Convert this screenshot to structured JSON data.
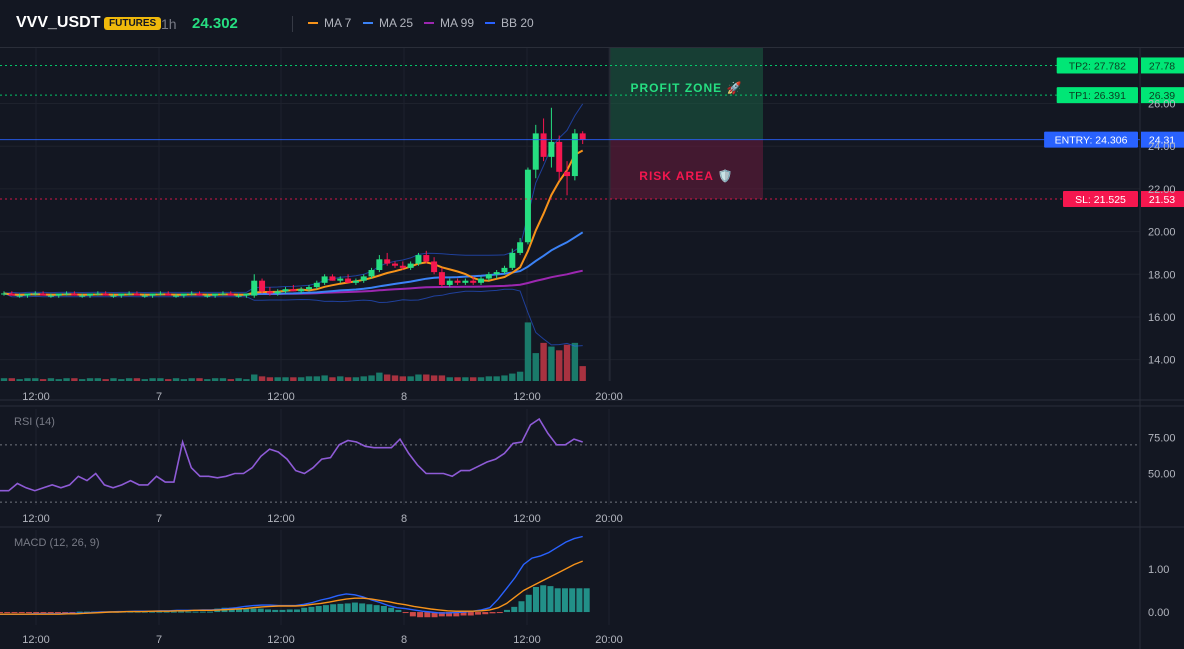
{
  "header": {
    "symbol": "VVV_USDT",
    "badge": "FUTURES",
    "timeframe": "1h",
    "price": "24.302",
    "legend": [
      {
        "label": "MA 7",
        "color": "#f7931a"
      },
      {
        "label": "MA 25",
        "color": "#3b82f6"
      },
      {
        "label": "MA 99",
        "color": "#9c27b0"
      },
      {
        "label": "BB 20",
        "color": "#2962ff"
      }
    ]
  },
  "colors": {
    "up": "#26de81",
    "down": "#f5174f",
    "vol_up": "#1a7a6a",
    "vol_down": "#a83240"
  },
  "time_labels": [
    "12:00",
    "7",
    "12:00",
    "8",
    "12:00",
    "20:00"
  ],
  "zones": {
    "profit": "PROFIT ZONE 🚀",
    "risk": "RISK AREA 🛡️"
  },
  "chart_data": [
    {
      "type": "candlestick",
      "title": "",
      "ylim": [
        13,
        28.6
      ],
      "y_ticks": [
        "14.00",
        "16.00",
        "18.00",
        "20.00",
        "22.00",
        "24.00",
        "26.00"
      ],
      "x_ticks": [
        "12:00",
        "7",
        "12:00",
        "8",
        "12:00",
        "20:00"
      ],
      "candles": [
        [
          17.1,
          17.2,
          17.0,
          17.1
        ],
        [
          17.1,
          17.2,
          17.0,
          17.0
        ],
        [
          17.0,
          17.1,
          16.9,
          17.0
        ],
        [
          17.0,
          17.1,
          16.9,
          17.1
        ],
        [
          17.1,
          17.2,
          17.0,
          17.1
        ],
        [
          17.1,
          17.2,
          17.0,
          17.0
        ],
        [
          17.0,
          17.1,
          16.9,
          17.0
        ],
        [
          17.0,
          17.1,
          16.9,
          17.1
        ],
        [
          17.1,
          17.2,
          17.0,
          17.1
        ],
        [
          17.1,
          17.2,
          17.0,
          17.0
        ],
        [
          17.0,
          17.1,
          16.9,
          17.0
        ],
        [
          17.0,
          17.1,
          16.9,
          17.1
        ],
        [
          17.1,
          17.2,
          17.0,
          17.1
        ],
        [
          17.1,
          17.2,
          17.0,
          17.0
        ],
        [
          17.0,
          17.1,
          16.9,
          17.0
        ],
        [
          17.0,
          17.1,
          16.9,
          17.1
        ],
        [
          17.1,
          17.2,
          17.0,
          17.1
        ],
        [
          17.1,
          17.2,
          17.0,
          17.0
        ],
        [
          17.0,
          17.1,
          16.9,
          17.0
        ],
        [
          17.0,
          17.1,
          16.9,
          17.1
        ],
        [
          17.1,
          17.2,
          17.0,
          17.1
        ],
        [
          17.1,
          17.2,
          17.0,
          17.0
        ],
        [
          17.0,
          17.1,
          16.9,
          17.0
        ],
        [
          17.0,
          17.1,
          16.9,
          17.1
        ],
        [
          17.1,
          17.2,
          17.0,
          17.1
        ],
        [
          17.1,
          17.2,
          17.0,
          17.0
        ],
        [
          17.0,
          17.1,
          16.9,
          17.0
        ],
        [
          17.0,
          17.1,
          16.9,
          17.1
        ],
        [
          17.1,
          17.2,
          17.0,
          17.1
        ],
        [
          17.1,
          17.2,
          17.0,
          17.0
        ],
        [
          17.0,
          17.1,
          16.9,
          17.0
        ],
        [
          17.0,
          17.1,
          16.9,
          17.1
        ],
        [
          17.0,
          18.0,
          16.9,
          17.7
        ],
        [
          17.7,
          17.8,
          17.1,
          17.2
        ],
        [
          17.2,
          17.4,
          17.0,
          17.1
        ],
        [
          17.1,
          17.3,
          17.0,
          17.2
        ],
        [
          17.2,
          17.4,
          17.1,
          17.3
        ],
        [
          17.3,
          17.5,
          17.2,
          17.2
        ],
        [
          17.2,
          17.4,
          17.1,
          17.3
        ],
        [
          17.3,
          17.5,
          17.2,
          17.4
        ],
        [
          17.4,
          17.7,
          17.3,
          17.6
        ],
        [
          17.6,
          18.0,
          17.5,
          17.9
        ],
        [
          17.9,
          18.0,
          17.7,
          17.7
        ],
        [
          17.7,
          17.9,
          17.6,
          17.8
        ],
        [
          17.8,
          18.0,
          17.6,
          17.6
        ],
        [
          17.6,
          17.8,
          17.5,
          17.7
        ],
        [
          17.7,
          18.0,
          17.6,
          17.9
        ],
        [
          17.9,
          18.3,
          17.8,
          18.2
        ],
        [
          18.2,
          18.9,
          18.1,
          18.7
        ],
        [
          18.7,
          19.0,
          18.4,
          18.5
        ],
        [
          18.5,
          18.6,
          18.3,
          18.4
        ],
        [
          18.4,
          18.6,
          18.2,
          18.3
        ],
        [
          18.3,
          18.6,
          18.2,
          18.5
        ],
        [
          18.5,
          19.0,
          18.4,
          18.9
        ],
        [
          18.9,
          19.1,
          18.5,
          18.6
        ],
        [
          18.6,
          18.8,
          18.0,
          18.1
        ],
        [
          18.1,
          18.3,
          17.4,
          17.5
        ],
        [
          17.5,
          17.8,
          17.4,
          17.7
        ],
        [
          17.7,
          17.8,
          17.5,
          17.6
        ],
        [
          17.6,
          17.8,
          17.5,
          17.7
        ],
        [
          17.7,
          17.9,
          17.5,
          17.6
        ],
        [
          17.6,
          17.9,
          17.5,
          17.8
        ],
        [
          17.8,
          18.1,
          17.7,
          18.0
        ],
        [
          18.0,
          18.2,
          17.8,
          18.1
        ],
        [
          18.1,
          18.4,
          18.0,
          18.3
        ],
        [
          18.3,
          19.2,
          18.2,
          19.0
        ],
        [
          19.0,
          19.7,
          18.9,
          19.5
        ],
        [
          19.5,
          23.0,
          19.4,
          22.9
        ],
        [
          22.9,
          25.0,
          22.5,
          24.6
        ],
        [
          24.6,
          25.3,
          23.3,
          23.5
        ],
        [
          23.5,
          25.8,
          23.0,
          24.2
        ],
        [
          24.2,
          24.5,
          22.4,
          22.8
        ],
        [
          22.8,
          23.3,
          21.7,
          22.6
        ],
        [
          22.6,
          24.8,
          22.4,
          24.6
        ],
        [
          24.6,
          24.7,
          24.1,
          24.3
        ]
      ],
      "volume": [
        0.3,
        0.3,
        0.2,
        0.3,
        0.3,
        0.2,
        0.3,
        0.2,
        0.3,
        0.3,
        0.2,
        0.3,
        0.3,
        0.2,
        0.3,
        0.2,
        0.3,
        0.3,
        0.2,
        0.3,
        0.3,
        0.2,
        0.3,
        0.2,
        0.3,
        0.3,
        0.2,
        0.3,
        0.3,
        0.2,
        0.3,
        0.2,
        0.7,
        0.5,
        0.4,
        0.4,
        0.4,
        0.4,
        0.4,
        0.5,
        0.5,
        0.6,
        0.4,
        0.5,
        0.4,
        0.4,
        0.5,
        0.6,
        0.9,
        0.7,
        0.6,
        0.5,
        0.5,
        0.7,
        0.7,
        0.6,
        0.6,
        0.4,
        0.4,
        0.4,
        0.4,
        0.4,
        0.5,
        0.5,
        0.6,
        0.8,
        1.0,
        6.3,
        3.0,
        4.1,
        3.7,
        3.3,
        3.9,
        4.1,
        1.6
      ],
      "levels": [
        {
          "label": "TP2: 27.782",
          "axis": "27.78",
          "value": 27.782,
          "color": "#00e676"
        },
        {
          "label": "TP1: 26.391",
          "axis": "26.39",
          "value": 26.391,
          "color": "#00e676"
        },
        {
          "label": "ENTRY: 24.306",
          "axis": "24.31",
          "value": 24.306,
          "color": "#2962ff"
        },
        {
          "label": "SL: 21.525",
          "axis": "21.53",
          "value": 21.525,
          "color": "#f5174f"
        }
      ]
    },
    {
      "type": "line",
      "title": "RSI (14)",
      "ylim": [
        28,
        95
      ],
      "y_ticks": [
        "75.00",
        "50.00"
      ],
      "bands": [
        70,
        30
      ],
      "x_ticks": [
        "12:00",
        "7",
        "12:00",
        "8",
        "12:00",
        "20:00"
      ],
      "values": [
        38,
        38,
        43,
        40,
        38,
        40,
        42,
        40,
        42,
        48,
        45,
        50,
        42,
        40,
        42,
        45,
        42,
        42,
        48,
        44,
        44,
        72,
        54,
        48,
        48,
        47,
        48,
        50,
        50,
        54,
        62,
        67,
        65,
        60,
        52,
        50,
        54,
        60,
        61,
        70,
        73,
        72,
        69,
        68,
        68,
        68,
        74,
        64,
        56,
        50,
        50,
        50,
        48,
        52,
        52,
        55,
        58,
        60,
        64,
        71,
        72,
        84,
        88,
        78,
        70,
        70,
        74,
        72
      ]
    },
    {
      "type": "bar",
      "title": "MACD (12, 26, 9)",
      "ylim": [
        -0.3,
        1.9
      ],
      "y_ticks": [
        "1.00",
        "0.00"
      ],
      "x_ticks": [
        "12:00",
        "7",
        "12:00",
        "8",
        "12:00",
        "20:00"
      ],
      "histogram": [
        -0.02,
        -0.02,
        -0.02,
        -0.02,
        -0.02,
        -0.02,
        -0.02,
        -0.02,
        -0.02,
        -0.02,
        -0.01,
        0.01,
        0.01,
        0.01,
        0.01,
        0.01,
        0.01,
        0.01,
        0.01,
        0.01,
        0.01,
        0.01,
        0.01,
        0.01,
        0.01,
        0.01,
        0.01,
        0.01,
        0.01,
        0.01,
        0.08,
        0.1,
        0.1,
        0.08,
        0.08,
        0.08,
        0.08,
        0.06,
        0.05,
        0.05,
        0.06,
        0.06,
        0.1,
        0.12,
        0.14,
        0.16,
        0.18,
        0.19,
        0.2,
        0.22,
        0.2,
        0.18,
        0.16,
        0.14,
        0.1,
        0.05,
        -0.02,
        -0.1,
        -0.12,
        -0.12,
        -0.12,
        -0.1,
        -0.1,
        -0.1,
        -0.08,
        -0.08,
        -0.06,
        -0.05,
        -0.03,
        -0.02,
        0.05,
        0.12,
        0.25,
        0.4,
        0.58,
        0.62,
        0.6,
        0.55,
        0.55,
        0.55,
        0.55,
        0.55
      ],
      "macd": [
        -0.05,
        -0.05,
        -0.05,
        -0.05,
        -0.04,
        -0.04,
        -0.04,
        -0.04,
        -0.03,
        -0.03,
        -0.02,
        -0.01,
        0.0,
        0.0,
        0.01,
        0.01,
        0.02,
        0.02,
        0.02,
        0.03,
        0.03,
        0.04,
        0.04,
        0.04,
        0.05,
        0.05,
        0.06,
        0.08,
        0.1,
        0.13,
        0.15,
        0.16,
        0.16,
        0.15,
        0.15,
        0.15,
        0.18,
        0.22,
        0.28,
        0.32,
        0.38,
        0.42,
        0.4,
        0.35,
        0.28,
        0.22,
        0.15,
        0.1,
        0.08,
        0.05,
        0.02,
        0.0,
        -0.02,
        -0.02,
        -0.01,
        0.0,
        0.02,
        0.05,
        0.1,
        0.3,
        0.55,
        0.8,
        1.1,
        1.25,
        1.3,
        1.38,
        1.5,
        1.62,
        1.7,
        1.75
      ],
      "signal": [
        -0.05,
        -0.05,
        -0.05,
        -0.05,
        -0.05,
        -0.05,
        -0.05,
        -0.05,
        -0.04,
        -0.04,
        -0.03,
        -0.02,
        -0.01,
        0.0,
        0.0,
        0.01,
        0.01,
        0.01,
        0.02,
        0.02,
        0.02,
        0.03,
        0.03,
        0.04,
        0.04,
        0.04,
        0.05,
        0.06,
        0.07,
        0.08,
        0.1,
        0.12,
        0.13,
        0.14,
        0.14,
        0.14,
        0.15,
        0.18,
        0.2,
        0.23,
        0.27,
        0.3,
        0.32,
        0.32,
        0.3,
        0.27,
        0.24,
        0.2,
        0.17,
        0.13,
        0.1,
        0.07,
        0.05,
        0.03,
        0.02,
        0.02,
        0.02,
        0.03,
        0.05,
        0.1,
        0.2,
        0.35,
        0.5,
        0.6,
        0.7,
        0.8,
        0.9,
        1.0,
        1.1,
        1.18
      ]
    }
  ]
}
